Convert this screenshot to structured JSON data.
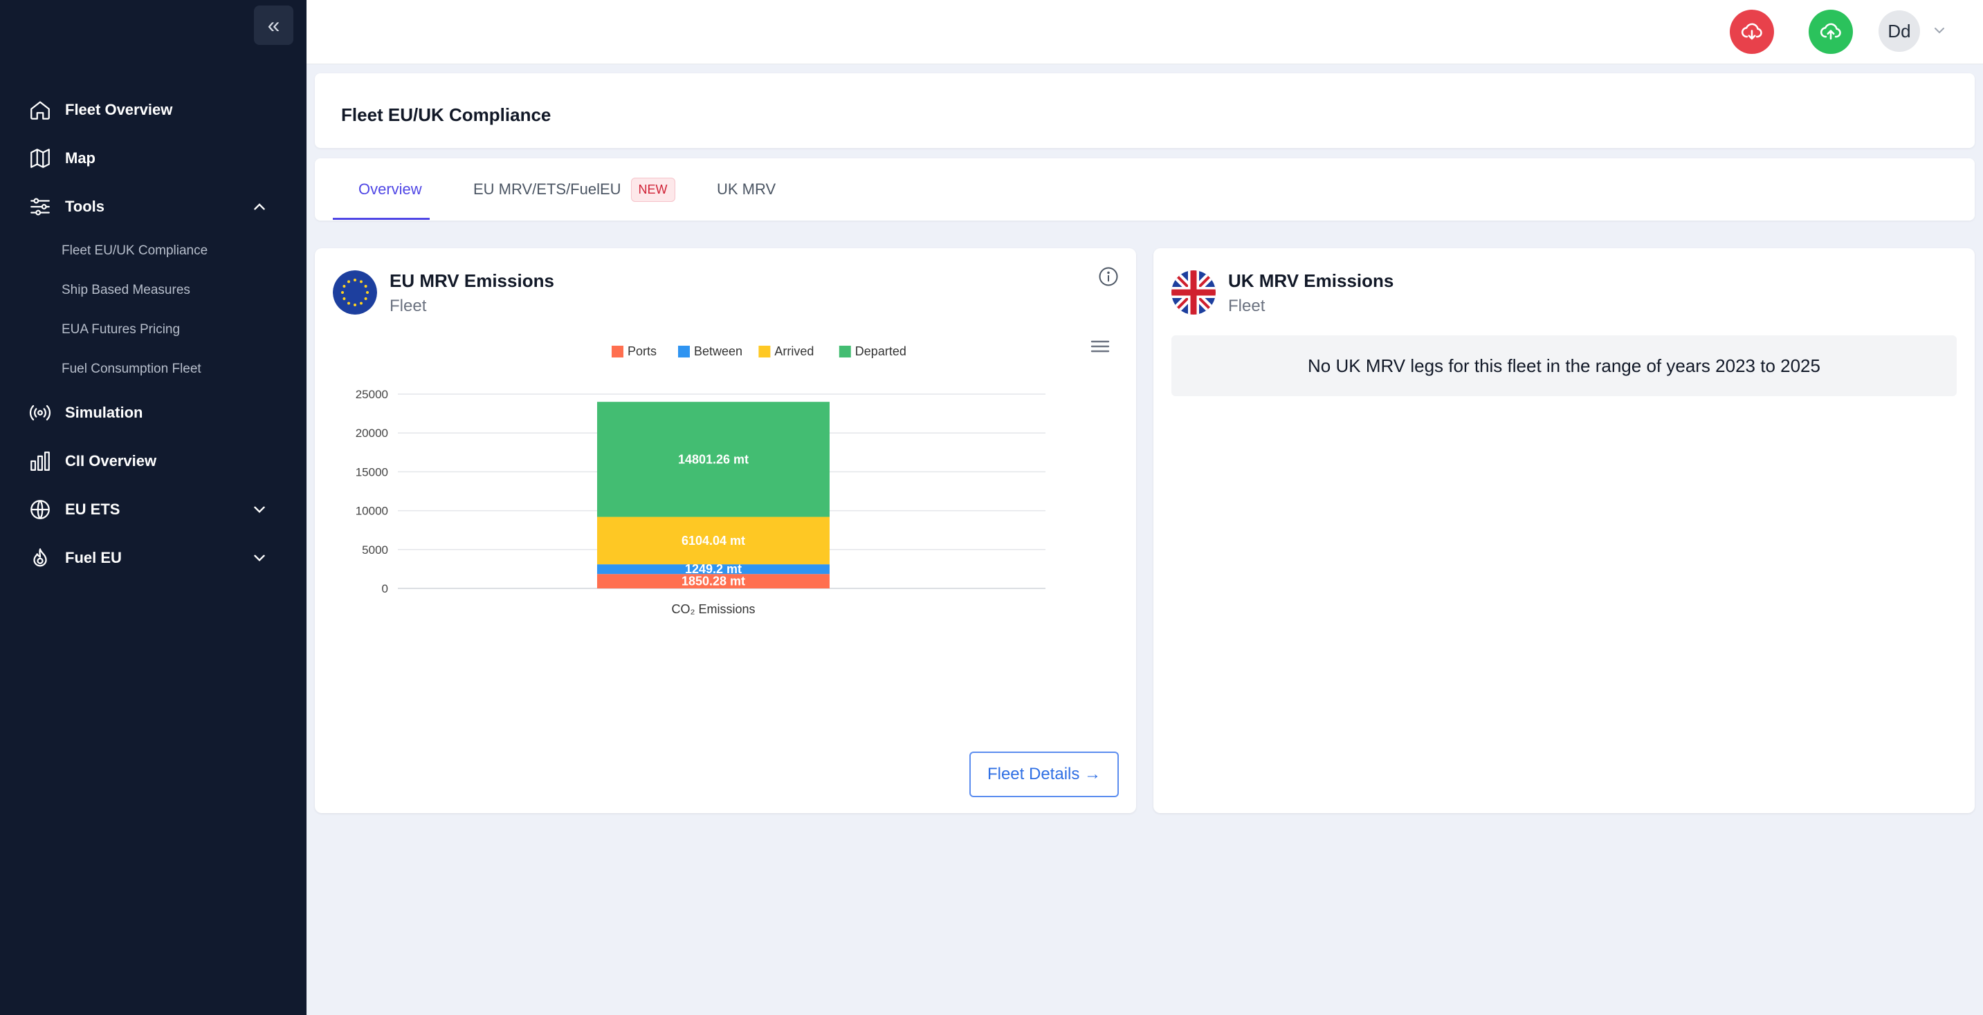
{
  "sidebar": {
    "collapse_icon": "chevrons-left-icon",
    "items": [
      {
        "label": "Fleet Overview",
        "icon": "home-icon"
      },
      {
        "label": "Map",
        "icon": "map-icon"
      },
      {
        "label": "Tools",
        "icon": "sliders-icon",
        "expanded": true
      },
      {
        "label": "Simulation",
        "icon": "broadcast-icon"
      },
      {
        "label": "CII Overview",
        "icon": "bar-chart-icon"
      },
      {
        "label": "EU ETS",
        "icon": "globe-icon",
        "expanded": false
      },
      {
        "label": "Fuel EU",
        "icon": "flame-icon",
        "expanded": false
      }
    ],
    "tools_sub": [
      "Fleet EU/UK Compliance",
      "Ship Based Measures",
      "EUA Futures Pricing",
      "Fuel Consumption Fleet"
    ]
  },
  "topbar": {
    "download_icon": "cloud-download-icon",
    "upload_icon": "cloud-upload-icon",
    "avatar": "Dd",
    "download_color": "#e8414b",
    "upload_color": "#2bc25c"
  },
  "page": {
    "title": "Fleet EU/UK Compliance"
  },
  "tabs": [
    {
      "label": "Overview",
      "active": true
    },
    {
      "label": "EU MRV/ETS/FuelEU",
      "badge": "NEW"
    },
    {
      "label": "UK MRV"
    }
  ],
  "eu_card": {
    "title": "EU MRV Emissions",
    "subtitle": "Fleet",
    "button": "Fleet Details →"
  },
  "uk_card": {
    "title": "UK MRV Emissions",
    "subtitle": "Fleet",
    "message": "No UK MRV legs for this fleet in the range of years 2023 to 2025"
  },
  "chart_data": {
    "type": "bar",
    "stacked": true,
    "categories": [
      "CO₂ Emissions"
    ],
    "series": [
      {
        "name": "Ports",
        "values": [
          1850.28
        ],
        "label": "1850.28 mt",
        "color": "#ff6f4f"
      },
      {
        "name": "Between",
        "values": [
          1249.2
        ],
        "label": "1249.2 mt",
        "color": "#2f94f1"
      },
      {
        "name": "Arrived",
        "values": [
          6104.04
        ],
        "label": "6104.04 mt",
        "color": "#fec824"
      },
      {
        "name": "Departed",
        "values": [
          14801.26
        ],
        "label": "14801.26 mt",
        "color": "#43bd72"
      }
    ],
    "yticks": [
      "0",
      "5000",
      "10000",
      "15000",
      "20000",
      "25000"
    ],
    "ylim": [
      0,
      25000
    ],
    "legend": "top",
    "grid": true,
    "title": "",
    "xlabel": "",
    "ylabel": ""
  }
}
